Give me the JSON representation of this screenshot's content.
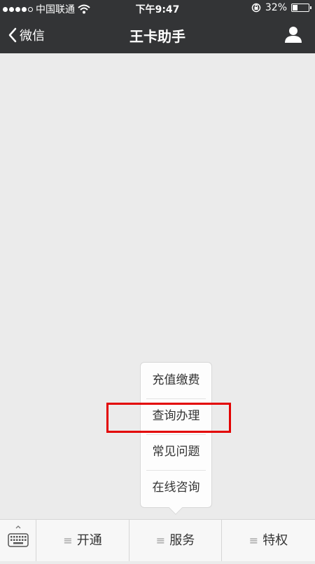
{
  "status_bar": {
    "carrier": "中国联通",
    "time": "下午9:47",
    "battery": "32%",
    "battery_level": 0.32,
    "icons": [
      "signal-dots-icon",
      "wifi-icon",
      "orientation-lock-icon",
      "battery-icon"
    ]
  },
  "nav": {
    "back_label": "微信",
    "title": "王卡助手",
    "icons": [
      "chevron-left-icon",
      "profile-icon"
    ]
  },
  "popup_menu": {
    "items": [
      {
        "label": "充值缴费"
      },
      {
        "label": "查询办理"
      },
      {
        "label": "常见问题"
      },
      {
        "label": "在线咨询"
      }
    ],
    "highlight_color": "#e30000"
  },
  "bottom_bar": {
    "keyboard_icon": "keyboard-icon",
    "tabs": [
      {
        "label": "开通"
      },
      {
        "label": "服务"
      },
      {
        "label": "特权"
      }
    ]
  },
  "colors": {
    "header_bg": "#333436",
    "content_bg": "#ebebeb",
    "bottom_bg": "#f7f7f7",
    "highlight": "#e30000"
  }
}
